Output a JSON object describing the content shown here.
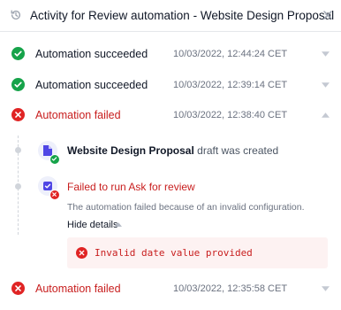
{
  "header": {
    "title": "Activity for Review automation - Website Design Proposal",
    "history_icon": "history-icon",
    "close_icon": "close-icon"
  },
  "runs": [
    {
      "status": "success",
      "label": "Automation succeeded",
      "time": "10/03/2022, 12:44:24 CET",
      "expanded": false
    },
    {
      "status": "success",
      "label": "Automation succeeded",
      "time": "10/03/2022, 12:39:14 CET",
      "expanded": false
    },
    {
      "status": "failed",
      "label": "Automation failed",
      "time": "10/03/2022, 12:38:40 CET",
      "expanded": true
    },
    {
      "status": "failed",
      "label": "Automation failed",
      "time": "10/03/2022, 12:35:58 CET",
      "expanded": false
    }
  ],
  "details": {
    "step1": {
      "name": "Website Design Proposal",
      "rest": " draft was created",
      "icon": "document-icon",
      "badge": "success"
    },
    "step2": {
      "text": "Failed to run Ask for review",
      "icon": "checkbox-icon",
      "badge": "error"
    },
    "description": "The automation failed because of an invalid configuration.",
    "hide_details_label": "Hide details",
    "error_message": "Invalid date value provided"
  },
  "colors": {
    "success": "#16a34a",
    "error": "#e02424",
    "error_text": "#c81e1e",
    "accent": "#4f46e5"
  }
}
